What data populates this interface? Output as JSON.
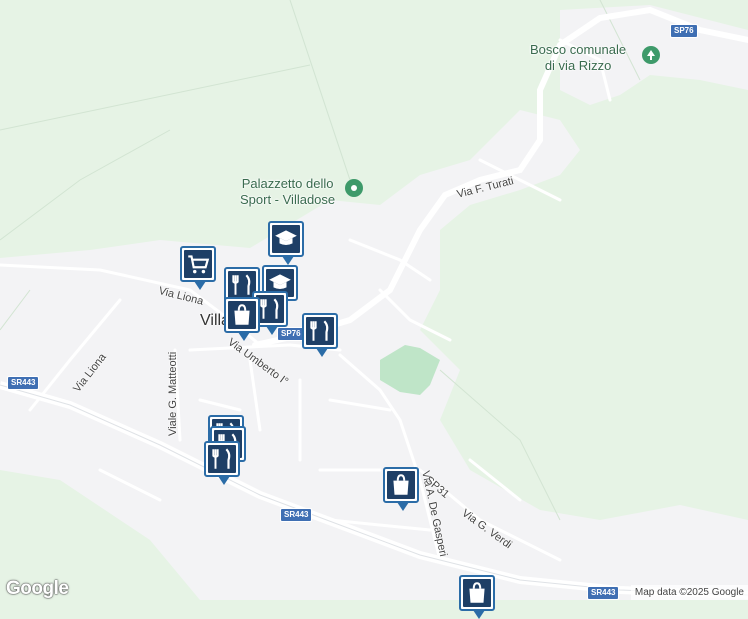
{
  "map": {
    "colors": {
      "land": "#e6f3e5",
      "urban": "#f3f3f5",
      "road": "#ffffff",
      "park": "#bfe5c8",
      "pin_border": "#2b6ca7",
      "pin_fill": "#1e3f66",
      "shield": "#3f6fb3"
    },
    "town_label": "Villa",
    "pois": {
      "bosco_line1": "Bosco comunale",
      "bosco_line2": "di via Rizzo",
      "palazzetto_line1": "Palazzetto dello",
      "palazzetto_line2": "Sport - Villadose"
    },
    "roads": {
      "via_liona_1": "Via Liona",
      "via_liona_2": "Via Liona",
      "viale_matteotti": "Viale G. Matteotti",
      "via_umberto": "Via Umberto I°",
      "via_turati": "Via F. Turati",
      "via_de_gasperi": "Via A. De Gasperi",
      "via_sp31": "SP31",
      "via_verdi": "Via G. Verdi"
    },
    "shields": {
      "sp76_top": "SP76",
      "sp76_center": "SP76",
      "sr443_left": "SR443",
      "sr443_center": "SR443",
      "sr443_right": "SR443"
    },
    "markers": [
      {
        "icon": "shopping-cart-icon"
      },
      {
        "icon": "graduation-cap-icon"
      },
      {
        "icon": "graduation-cap-icon"
      },
      {
        "icon": "restaurant-icon"
      },
      {
        "icon": "restaurant-icon"
      },
      {
        "icon": "restaurant-icon"
      },
      {
        "icon": "shopping-bag-icon"
      },
      {
        "icon": "restaurant-icon"
      },
      {
        "icon": "restaurant-icon"
      },
      {
        "icon": "restaurant-icon"
      },
      {
        "icon": "shopping-bag-icon"
      },
      {
        "icon": "shopping-bag-icon"
      }
    ],
    "google_logo": "Google",
    "attribution": "Map data ©2025 Google"
  }
}
